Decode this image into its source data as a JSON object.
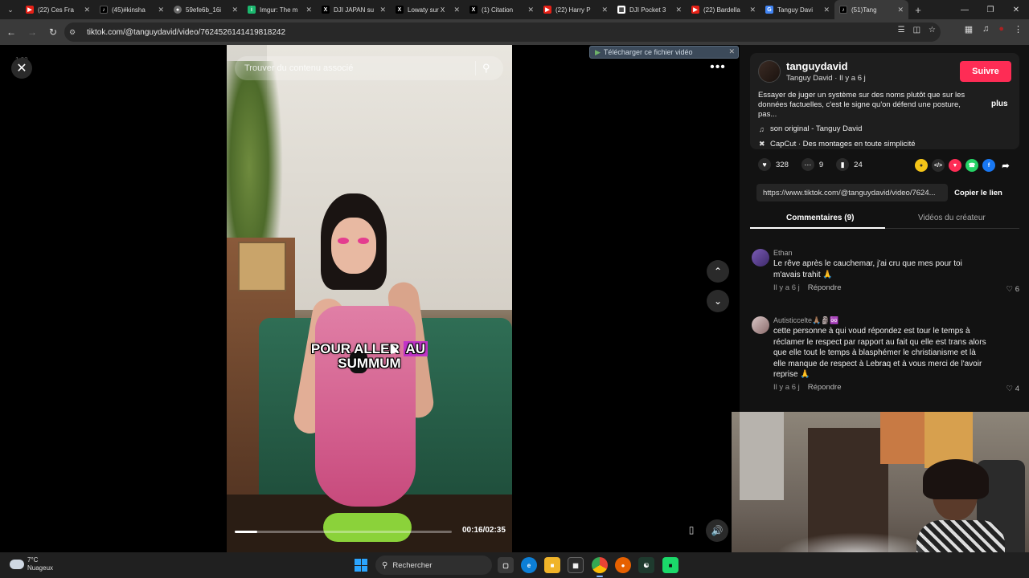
{
  "browser": {
    "tabs": [
      {
        "title": "(22) Ces Fra",
        "favicon": "youtube-icon",
        "active": false
      },
      {
        "title": "(45)#kinsha",
        "favicon": "tiktok-icon",
        "active": false
      },
      {
        "title": "59efe6b_16i",
        "favicon": "globe-icon",
        "active": false
      },
      {
        "title": "Imgur: The m",
        "favicon": "imgur-icon",
        "active": false
      },
      {
        "title": "DJI JAPAN su",
        "favicon": "x-icon",
        "active": false
      },
      {
        "title": "Lowaty sur X",
        "favicon": "x-icon",
        "active": false
      },
      {
        "title": "(1) Citation",
        "favicon": "x-icon",
        "active": false
      },
      {
        "title": "(22) Harry P",
        "favicon": "youtube-icon",
        "active": false
      },
      {
        "title": "DJI Pocket 3",
        "favicon": "bookmark-icon",
        "active": false
      },
      {
        "title": "(22) Bardella",
        "favicon": "youtube-icon",
        "active": false
      },
      {
        "title": "Tanguy Davi",
        "favicon": "google-icon",
        "active": false
      },
      {
        "title": "(51)Tang",
        "favicon": "tiktok-icon",
        "active": true
      }
    ],
    "new_tab": "+",
    "url": "tiktok.com/@tanguydavid/video/7624526141419818242"
  },
  "video": {
    "search_placeholder": "Trouver du contenu associé",
    "caption_plain": "POUR ALLER",
    "caption_highlight": "AU",
    "caption_line2": "SUMMUM",
    "time": "00:16/02:35",
    "progress": 0.103,
    "download_label": "Télécharger ce fichier vidéo",
    "corner_label": "1.00"
  },
  "post": {
    "username": "tanguydavid",
    "display_name": "Tanguy David",
    "age": "Il y a 6 j",
    "follow_label": "Suivre",
    "description": "Essayer de juger un système sur des noms plutôt que sur les données factuelles, c'est le signe qu'on défend une posture, pas...",
    "more_label": "plus",
    "music": "son original - Tanguy David",
    "capcut": "CapCut · Des montages en toute simplicité",
    "likes": "328",
    "comments": "9",
    "saves": "24",
    "link": "https://www.tiktok.com/@tanguydavid/video/7624...",
    "copy_label": "Copier le lien",
    "tab_comments": "Commentaires (9)",
    "tab_videos": "Vidéos du créateur"
  },
  "comments": [
    {
      "author": "Ethan",
      "text": "Le rêve après le cauchemar, j'ai cru que mes pour toi m'avais trahit 🙏",
      "age": "Il y a 6 j",
      "reply": "Répondre",
      "likes": "6"
    },
    {
      "author": "Autisticcelte🙏🏽🗿♾️",
      "text": "cette personne à qui voud répondez est tour le temps à réclamer le respect par rapport au fait qu elle est trans alors que elle tout le temps à blasphémer le christianisme et là elle manque de respect à Lebraq et à vous merci de l'avoir reprise 🙏",
      "age": "Il y a 6 j",
      "reply": "Répondre",
      "likes": "4"
    }
  ],
  "taskbar": {
    "temp": "7°C",
    "weather": "Nuageux",
    "search_label": "Rechercher"
  },
  "colors": {
    "accent": "#fe2c55",
    "caption_highlight": "#c234c9"
  }
}
